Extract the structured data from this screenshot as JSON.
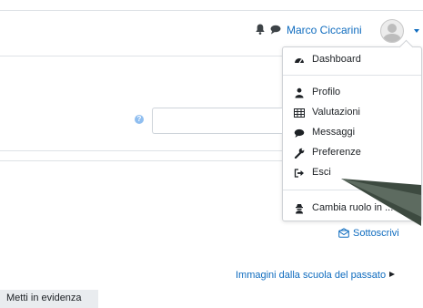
{
  "header": {
    "user_name": "Marco Ciccarini",
    "notifications_icon": "bell-icon",
    "messages_icon": "chat-bubble-icon",
    "menu_caret_icon": "caret-down-icon"
  },
  "user_menu": {
    "items": [
      {
        "label": "Dashboard",
        "icon": "dashboard-icon"
      },
      {
        "label": "Profilo",
        "icon": "user-icon"
      },
      {
        "label": "Valutazioni",
        "icon": "table-icon"
      },
      {
        "label": "Messaggi",
        "icon": "chat-bubble-icon"
      },
      {
        "label": "Preferenze",
        "icon": "wrench-icon"
      },
      {
        "label": "Esci",
        "icon": "sign-out-icon"
      },
      {
        "label": "Cambia ruolo in ...",
        "icon": "user-secret-icon"
      }
    ]
  },
  "help_icon": "question-circle-icon",
  "links": {
    "subscribe": "Sottoscrivi",
    "subscribe_icon": "envelope-icon",
    "past_images": "Immagini dalla scuola del passato",
    "past_images_icon": "arrow-right-icon"
  },
  "feature_bar": {
    "label": "Metti in evidenza"
  },
  "colors": {
    "link": "#0f6cbf",
    "pointer_arrow": "#3d4a40"
  }
}
